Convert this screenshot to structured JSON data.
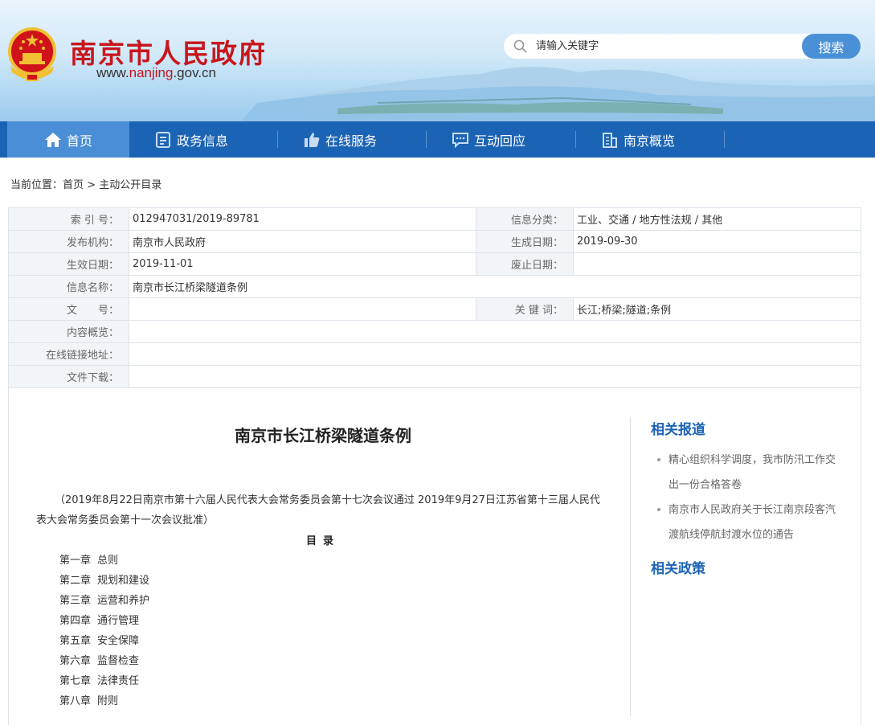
{
  "header": {
    "site_title": "南京市人民政府",
    "url_prefix": "www.",
    "url_highlight": "nanjing",
    "url_suffix": ".gov.cn",
    "search": {
      "placeholder": "请输入关键字",
      "button_label": "搜索"
    }
  },
  "nav": {
    "items": [
      {
        "label": "首页",
        "icon": "home-icon"
      },
      {
        "label": "政务信息",
        "icon": "document-icon"
      },
      {
        "label": "在线服务",
        "icon": "thumbs-up-icon"
      },
      {
        "label": "互动回应",
        "icon": "chat-icon"
      },
      {
        "label": "南京概览",
        "icon": "building-icon"
      }
    ],
    "active_index": 0
  },
  "breadcrumb": {
    "prefix": "当前位置：",
    "home": "首页",
    "separator": " > ",
    "current": "主动公开目录"
  },
  "meta": {
    "index_no_label": "索 引 号：",
    "index_no": "012947031/2019-89781",
    "category_label": "信息分类：",
    "category": "工业、交通 / 地方性法规 / 其他",
    "publisher_label": "发布机构：",
    "publisher": "南京市人民政府",
    "created_label": "生成日期：",
    "created": "2019-09-30",
    "effective_label": "生效日期：",
    "effective": "2019-11-01",
    "abolished_label": "废止日期：",
    "abolished": "",
    "name_label": "信息名称：",
    "name": "南京市长江桥梁隧道条例",
    "doc_no_label": "文　　号：",
    "doc_no": "",
    "keywords_label": "关 键 词：",
    "keywords": "长江;桥梁;隧道;条例",
    "summary_label": "内容概览：",
    "summary": "",
    "link_label": "在线链接地址：",
    "link": "",
    "download_label": "文件下载：",
    "download": ""
  },
  "article": {
    "title": "南京市长江桥梁隧道条例",
    "note": "（2019年8月22日南京市第十六届人民代表大会常务委员会第十七次会议通过  2019年9月27日江苏省第十三届人民代表大会常务委员会第十一次会议批准）",
    "toc_heading": "目录",
    "toc": [
      {
        "chapter": "第一章",
        "title": "总则"
      },
      {
        "chapter": "第二章",
        "title": "规划和建设"
      },
      {
        "chapter": "第三章",
        "title": "运营和养护"
      },
      {
        "chapter": "第四章",
        "title": "通行管理"
      },
      {
        "chapter": "第五章",
        "title": "安全保障"
      },
      {
        "chapter": "第六章",
        "title": "监督检查"
      },
      {
        "chapter": "第七章",
        "title": "法律责任"
      },
      {
        "chapter": "第八章",
        "title": "附则"
      }
    ]
  },
  "sidebar": {
    "related_reports_title": "相关报道",
    "related_reports": [
      "精心组织科学调度，我市防汛工作交出一份合格答卷",
      "南京市人民政府关于长江南京段客汽渡航线停航封渡水位的通告"
    ],
    "related_policies_title": "相关政策"
  },
  "colors": {
    "brand_red": "#c8161d",
    "nav_blue": "#1b63b4",
    "nav_active": "#4a8fd6",
    "link_blue": "#1b63b4"
  }
}
